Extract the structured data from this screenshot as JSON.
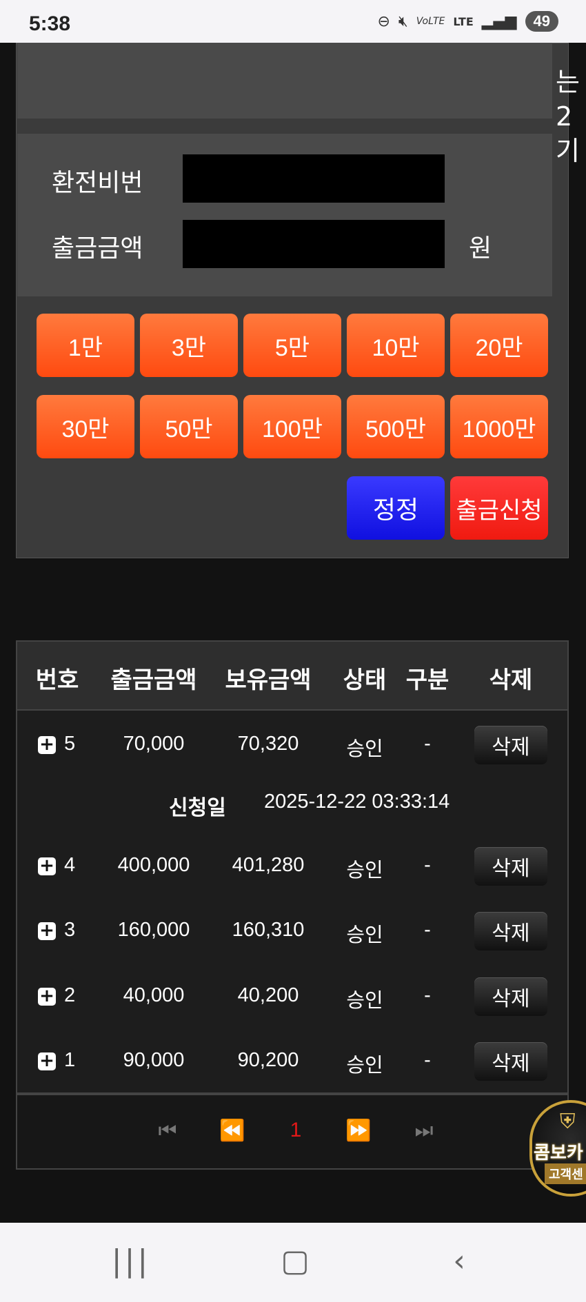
{
  "status_bar": {
    "time": "5:38",
    "network": "LTE",
    "battery": "49"
  },
  "top_side_text": "는2\n기",
  "form": {
    "pin_label": "환전비번",
    "amount_label": "출금금액",
    "amount_unit": "원",
    "pin_value": "",
    "amount_value": ""
  },
  "amount_buttons": [
    "1만",
    "3만",
    "5만",
    "10만",
    "20만",
    "30만",
    "50만",
    "100만",
    "500만",
    "1000만"
  ],
  "actions": {
    "reset_label": "정정",
    "submit_label": "출금신청"
  },
  "table": {
    "headers": [
      "번호",
      "출금금액",
      "보유금액",
      "상태",
      "구분",
      "삭제"
    ],
    "rows": [
      {
        "no": "5",
        "amount": "70,000",
        "balance": "70,320",
        "status": "승인",
        "type": "-",
        "delete": "삭제"
      },
      {
        "no": "4",
        "amount": "400,000",
        "balance": "401,280",
        "status": "승인",
        "type": "-",
        "delete": "삭제"
      },
      {
        "no": "3",
        "amount": "160,000",
        "balance": "160,310",
        "status": "승인",
        "type": "-",
        "delete": "삭제"
      },
      {
        "no": "2",
        "amount": "40,000",
        "balance": "40,200",
        "status": "승인",
        "type": "-",
        "delete": "삭제"
      },
      {
        "no": "1",
        "amount": "90,000",
        "balance": "90,200",
        "status": "승인",
        "type": "-",
        "delete": "삭제"
      }
    ],
    "detail": {
      "label": "신청일",
      "value": "2025-12-22 03:33:14"
    }
  },
  "pagination": {
    "current": "1"
  },
  "badge": {
    "title": "콤보카",
    "subtitle": "고객센"
  },
  "icons": {
    "accent_orange": "#ff5a1f",
    "accent_blue": "#1a1aff",
    "accent_red": "#f02a1a"
  }
}
